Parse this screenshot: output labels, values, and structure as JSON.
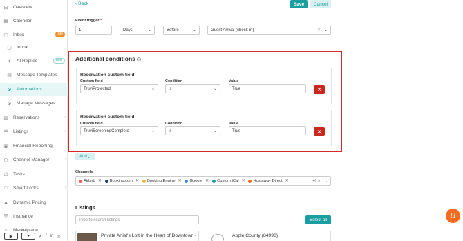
{
  "sidebar": {
    "items": [
      {
        "label": "Overview",
        "icon": "dashboard-icon"
      },
      {
        "label": "Calendar",
        "icon": "calendar-icon"
      },
      {
        "label": "Inbox",
        "icon": "chat-icon",
        "badge": "140"
      },
      {
        "label": "Inbox",
        "icon": "chat-icon"
      },
      {
        "label": "AI Replies",
        "icon": "sparkle-icon",
        "badge": "OFF"
      },
      {
        "label": "Message Templates",
        "icon": "template-icon"
      },
      {
        "label": "Automations",
        "icon": "gear-icon"
      },
      {
        "label": "Manage Messages",
        "icon": "settings-icon"
      },
      {
        "label": "Reservations",
        "icon": "reservation-icon"
      },
      {
        "label": "Listings",
        "icon": "list-icon"
      },
      {
        "label": "Financial Reporting",
        "icon": "report-icon"
      },
      {
        "label": "Channel Manager",
        "icon": "channel-icon"
      },
      {
        "label": "Tasks",
        "icon": "tasks-icon"
      },
      {
        "label": "Smart Locks",
        "icon": "lock-icon"
      },
      {
        "label": "Dynamic Pricing",
        "icon": "chart-icon"
      },
      {
        "label": "Insurance",
        "icon": "shield-icon"
      },
      {
        "label": "Marketplace",
        "icon": "store-icon"
      }
    ]
  },
  "header": {
    "back_label": "Back",
    "save_label": "Save",
    "cancel_label": "Cancel"
  },
  "trigger": {
    "label": "Event trigger",
    "required_mark": "*",
    "amount": "1",
    "unit": "Days",
    "when": "Before",
    "event": "Guest Arrival (check-in)"
  },
  "conditions": {
    "title": "Additional conditions",
    "items": [
      {
        "title": "Reservation custom field",
        "custom_field_label": "Custom field",
        "custom_field": "TruviProtected",
        "condition_label": "Condition",
        "condition": "is",
        "value_label": "Value",
        "value": "True"
      },
      {
        "title": "Reservation custom field",
        "custom_field_label": "Custom field",
        "custom_field": "TruviScreeningComplete",
        "condition_label": "Condition",
        "condition": "is",
        "value_label": "Value",
        "value": "True"
      }
    ],
    "add_label": "Add"
  },
  "channels": {
    "label": "Channels",
    "items": [
      {
        "name": "Airbnb",
        "color": "#ff5a5f"
      },
      {
        "name": "Booking.com",
        "color": "#1d3a6e"
      },
      {
        "name": "Booking Engine",
        "color": "#f2b33d"
      },
      {
        "name": "Google",
        "color": "#4285f4"
      },
      {
        "name": "Custom iCal",
        "color": "#1a9ea0"
      },
      {
        "name": "Hostaway Direct",
        "color": "#f46a1f"
      }
    ],
    "more": "+6"
  },
  "listings": {
    "heading": "Listings",
    "search_placeholder": "Type to search listings",
    "select_all": "Select all",
    "items": [
      {
        "name": "Private Artist's Loft in the Heart of Downtown -"
      },
      {
        "name": "Apple County  (84998)"
      }
    ]
  },
  "colors": {
    "accent": "#1a9ea0",
    "danger": "#c8281e",
    "highlight": "#d42a2a"
  }
}
